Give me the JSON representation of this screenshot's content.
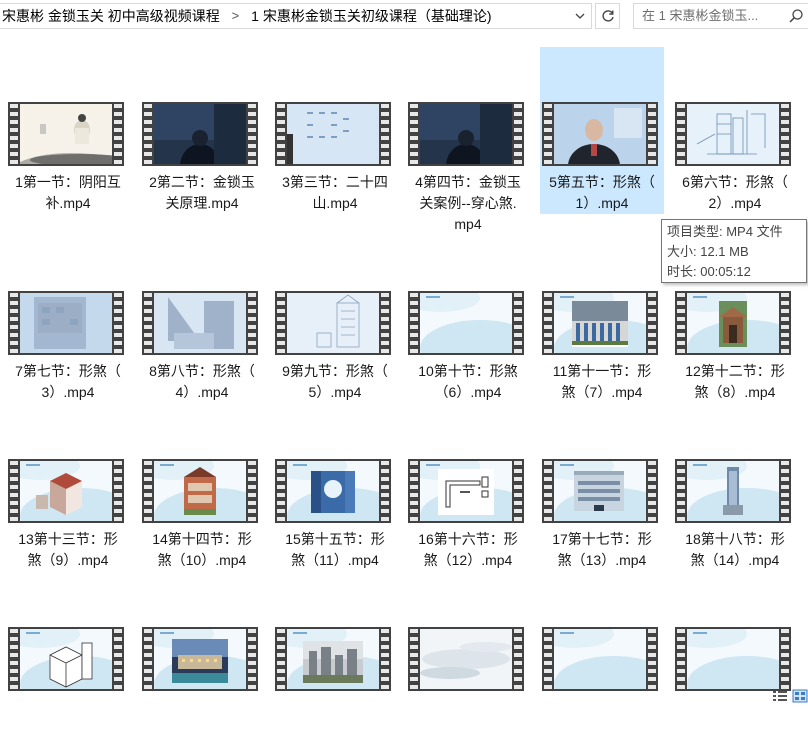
{
  "breadcrumb": {
    "items": [
      "宋惠彬 金锁玉关 初中高级视频课程",
      "1 宋惠彬金锁玉关初级课程（基础理论)"
    ],
    "separator": ">"
  },
  "search": {
    "placeholder": "在 1 宋惠彬金锁玉..."
  },
  "tooltip": {
    "type": "项目类型: MP4 文件",
    "size": "大小: 12.1 MB",
    "duration": "时长: 00:05:12"
  },
  "files": [
    {
      "line1": "1第一节：阴阳互",
      "line2": "补.mp4",
      "line3": "",
      "thumb": "ink"
    },
    {
      "line1": "2第二节：金锁玉",
      "line2": "关原理.mp4",
      "line3": "",
      "thumb": "dark"
    },
    {
      "line1": "3第三节：二十四",
      "line2": "山.mp4",
      "line3": "",
      "thumb": "board"
    },
    {
      "line1": "4第四节：金锁玉",
      "line2": "关案例--穿心煞.",
      "line3": "mp4",
      "thumb": "dark"
    },
    {
      "line1": "5第五节：形煞（",
      "line2": "1）.mp4",
      "line3": "",
      "thumb": "lecture"
    },
    {
      "line1": "6第六节：形煞（",
      "line2": "2）.mp4",
      "line3": "",
      "thumb": "sketch"
    },
    {
      "line1": "7第七节：形煞（",
      "line2": "3）.mp4",
      "line3": "",
      "thumb": "wall"
    },
    {
      "line1": "8第八节：形煞（",
      "line2": "4）.mp4",
      "line3": "",
      "thumb": "wedge"
    },
    {
      "line1": "9第九节：形煞（",
      "line2": "5）.mp4",
      "line3": "",
      "thumb": "tower"
    },
    {
      "line1": "10第十节：形煞",
      "line2": "（6）.mp4",
      "line3": "",
      "thumb": "slide"
    },
    {
      "line1": "11第十一节：形",
      "line2": "煞（7）.mp4",
      "line3": "",
      "thumb": "fence"
    },
    {
      "line1": "12第十二节：形",
      "line2": "煞（8）.mp4",
      "line3": "",
      "thumb": "hut"
    },
    {
      "line1": "13第十三节：形",
      "line2": "煞（9）.mp4",
      "line3": "",
      "thumb": "iso"
    },
    {
      "line1": "14第十四节：形",
      "line2": "煞（10）.mp4",
      "line3": "",
      "thumb": "church"
    },
    {
      "line1": "15第十五节：形",
      "line2": "煞（11）.mp4",
      "line3": "",
      "thumb": "blue"
    },
    {
      "line1": "16第十六节：形",
      "line2": "煞（12）.mp4",
      "line3": "",
      "thumb": "plan"
    },
    {
      "line1": "17第十七节：形",
      "line2": "煞（13）.mp4",
      "line3": "",
      "thumb": "building"
    },
    {
      "line1": "18第十八节：形",
      "line2": "煞（14）.mp4",
      "line3": "",
      "thumb": "tall"
    },
    {
      "line1": "",
      "line2": "",
      "line3": "",
      "thumb": "iso2"
    },
    {
      "line1": "",
      "line2": "",
      "line3": "",
      "thumb": "night"
    },
    {
      "line1": "",
      "line2": "",
      "line3": "",
      "thumb": "city"
    },
    {
      "line1": "",
      "line2": "",
      "line3": "",
      "thumb": "fog"
    },
    {
      "line1": "",
      "line2": "",
      "line3": "",
      "thumb": "slide"
    },
    {
      "line1": "",
      "line2": "",
      "line3": "",
      "thumb": "slide"
    }
  ],
  "colors": {
    "selection": "#cce8ff",
    "filmstrip": "#424242",
    "border": "#d9d9d9"
  }
}
